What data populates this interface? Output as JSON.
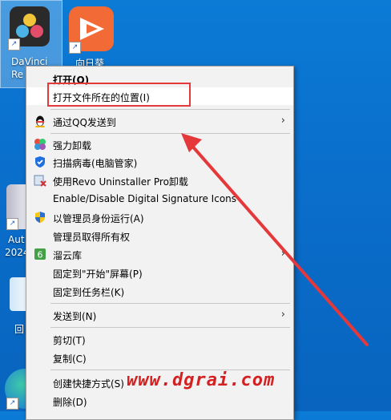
{
  "desktop": {
    "icons": [
      {
        "label_line1": "DaVinci",
        "label_line2": "Re"
      },
      {
        "label_line1": "向日葵"
      },
      {
        "label_line1": "Aut",
        "label_line2": "2024"
      },
      {
        "label_line1": "回"
      }
    ]
  },
  "context_menu": {
    "items": [
      {
        "label": "打开(O)",
        "bold": true
      },
      {
        "label": "打开文件所在的位置(I)"
      },
      {
        "label": "通过QQ发送到",
        "has_submenu": true
      },
      {
        "label": "强力卸载"
      },
      {
        "label": "扫描病毒(电脑管家)"
      },
      {
        "label": "使用Revo Uninstaller Pro卸载"
      },
      {
        "label": "Enable/Disable Digital Signature Icons"
      },
      {
        "label": "以管理员身份运行(A)"
      },
      {
        "label": "管理员取得所有权"
      },
      {
        "label": "溜云库",
        "has_submenu": true
      },
      {
        "label": "固定到\"开始\"屏幕(P)"
      },
      {
        "label": "固定到任务栏(K)"
      },
      {
        "label": "发送到(N)",
        "has_submenu": true
      },
      {
        "label": "剪切(T)"
      },
      {
        "label": "复制(C)"
      },
      {
        "label": "创建快捷方式(S)"
      },
      {
        "label": "删除(D)"
      }
    ],
    "submenu_glyph": "›"
  },
  "annotation": {
    "watermark": "www.dgrai.com",
    "highlight_color": "#e5383b"
  }
}
